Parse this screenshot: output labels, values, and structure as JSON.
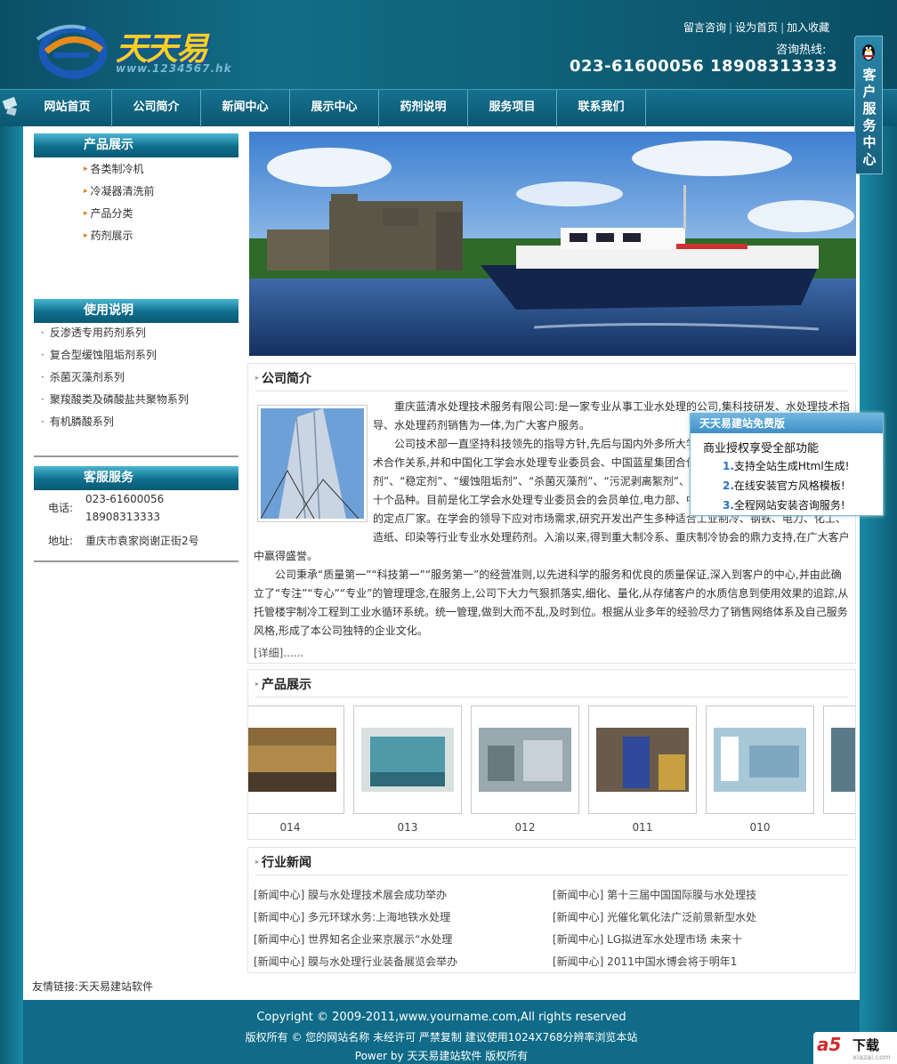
{
  "header": {
    "logo_text": "天天易",
    "logo_url": "www.1234567.hk",
    "top_links": [
      "留言咨询",
      "设为首页",
      "加入收藏"
    ],
    "hotline_label": "咨询热线:",
    "hotline_number": "023-61600056 18908313333"
  },
  "nav": [
    "网站首页",
    "公司简介",
    "新闻中心",
    "展示中心",
    "药剂说明",
    "服务项目",
    "联系我们"
  ],
  "service_tab": {
    "label": "客户服务中心",
    "icon": "qq-penguin-icon"
  },
  "sidebar": {
    "products": {
      "title": "产品展示",
      "items": [
        "各类制冷机",
        "冷凝器清洗前",
        "产品分类",
        "药剂展示"
      ]
    },
    "usage": {
      "title": "使用说明",
      "items": [
        "反渗透专用药剂系列",
        "复合型缓蚀阻垢剂系列",
        "杀菌灭藻剂系列",
        "聚羧酸类及磷酸盐共聚物系列",
        "有机膦酸系列"
      ]
    },
    "service": {
      "title": "客服服务",
      "phone_label": "电话:",
      "phone1": "023-61600056",
      "phone2": "18908313333",
      "address_label": "地址:",
      "address": "重庆市袁家岗谢正街2号"
    }
  },
  "intro": {
    "title": "公司简介",
    "paragraphs": [
      "重庆蓝清水处理技术服务有限公司:是一家专业从事工业水处理的公司,集科技研发、水处理技术指导、水处理药剂销售为一体,为广大客户服务。",
      "公司技术部一直坚持科技领先的指导方针,先后与国内外多所大学、科研院所建立了长期稳定的技术合作关系,并和中国化工学会水处理专业委员会、中国蓝星集团合作,研究开发了“阻垢剂”、“缓蚀剂”、“稳定剂”、“缓蚀阻垢剂”、“杀菌灭藻剂”、“污泥剥离絮剂”、“清洗剂”、“预膜剂”等系列产品几十个品种。目前是化工学会水处理专业委员会的会员单位,电力部、中石化、冶金部等单位水处理药剂的定点厂家。在学会的领导下应对市场需求,研究开发出产生多种适合工业制冷、钢铁、电力、化工、造纸、印染等行业专业水处理药剂。入渝以来,得到重大制冷系、重庆制冷协会的鼎力支持,在广大客户中赢得盛誉。",
      "公司秉承“质量第一”“科技第一”“服务第一”的经营准则,以先进科学的服务和优良的质量保证,深入到客户的中心,并由此确立了“专注”“专心”“专业”的管理理念,在服务上,公司下大力气狠抓落实,细化、量化,从存储客户的水质信息到使用效果的追踪,从托管楼宇制冷工程到工业水循环系统。统一管理,做到大而不乱,及时到位。根据从业多年的经验尽力了销售网络体系及自己服务风格,形成了本公司独特的企业文化。"
    ],
    "more": "[详细]......"
  },
  "products": {
    "title": "产品展示",
    "items": [
      {
        "caption": "014",
        "color": "#8a6a3a"
      },
      {
        "caption": "013",
        "color": "#4e9aa8"
      },
      {
        "caption": "012",
        "color": "#9aa8b0"
      },
      {
        "caption": "011",
        "color": "#6a5a4a"
      },
      {
        "caption": "010",
        "color": "#a8c8d8"
      }
    ]
  },
  "news": {
    "title": "行业新闻",
    "left": [
      "[新闻中心] 膜与水处理技术展会成功举办",
      "[新闻中心] 多元环球水务:上海地铁水处理",
      "[新闻中心] 世界知名企业来京展示“水处理",
      "[新闻中心] 膜与水处理行业装备展览会举办"
    ],
    "right": [
      "[新闻中心] 第十三届中国国际膜与水处理技",
      "[新闻中心] 光催化氧化法广泛前景新型水处",
      "[新闻中心] LG拟进军水处理市场 未来十",
      "[新闻中心] 2011中国水博会将于明年1"
    ]
  },
  "friend_links": "友情链接:天天易建站软件",
  "popup": {
    "title": "天天易建站免费版",
    "lead": "商业授权享受全部功能",
    "items": [
      {
        "num": "1.",
        "text": "支持全站生成Html生成!"
      },
      {
        "num": "2.",
        "text": "在线安装官方风格模板!"
      },
      {
        "num": "3.",
        "text": "全程网站安装咨询服务!"
      }
    ]
  },
  "footer": {
    "line1": "Copyright © 2009-2011,www.yourname.com,All rights reserved",
    "line2": "版权所有 © 您的网站名称  未经许可  严禁复制  建议使用1024X768分辨率浏览本站",
    "line3": "Power by 天天易建站软件  版权所有"
  },
  "watermark": {
    "brand": "a5",
    "label": "下载",
    "domain": "xiazai.com"
  }
}
